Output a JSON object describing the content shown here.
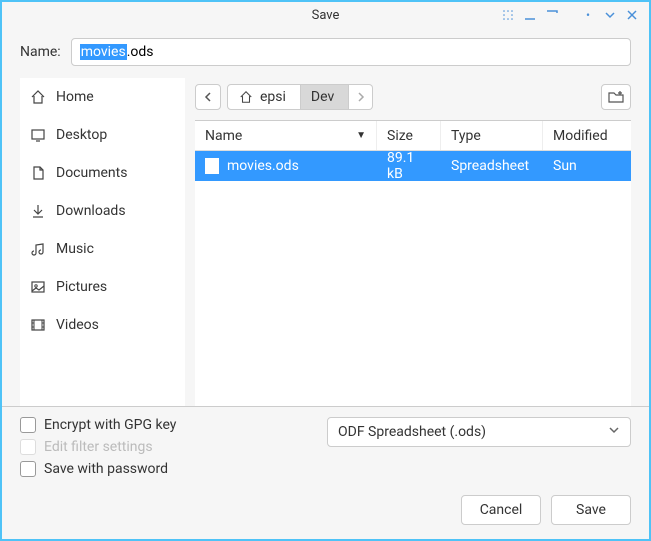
{
  "title": "Save",
  "name_label": "Name:",
  "filename": {
    "selected": "movies",
    "rest": ".ods"
  },
  "sidebar": {
    "items": [
      {
        "label": "Home",
        "icon": "home-icon"
      },
      {
        "label": "Desktop",
        "icon": "desktop-icon"
      },
      {
        "label": "Documents",
        "icon": "documents-icon"
      },
      {
        "label": "Downloads",
        "icon": "downloads-icon"
      },
      {
        "label": "Music",
        "icon": "music-icon"
      },
      {
        "label": "Pictures",
        "icon": "pictures-icon"
      },
      {
        "label": "Videos",
        "icon": "videos-icon"
      }
    ]
  },
  "path": {
    "segments": [
      {
        "label": "epsi",
        "has_home_icon": true,
        "active": false
      },
      {
        "label": "Dev",
        "has_home_icon": false,
        "active": true
      }
    ]
  },
  "columns": {
    "name": "Name",
    "size": "Size",
    "type": "Type",
    "modified": "Modified"
  },
  "files": [
    {
      "name": "movies.ods",
      "size": "89.1 kB",
      "type": "Spreadsheet",
      "modified": "Sun",
      "selected": true
    }
  ],
  "options": {
    "encrypt_gpg": "Encrypt with GPG key",
    "edit_filter": "Edit filter settings",
    "save_password": "Save with password"
  },
  "format": {
    "selected": "ODF Spreadsheet (.ods)"
  },
  "buttons": {
    "cancel": "Cancel",
    "save": "Save"
  }
}
